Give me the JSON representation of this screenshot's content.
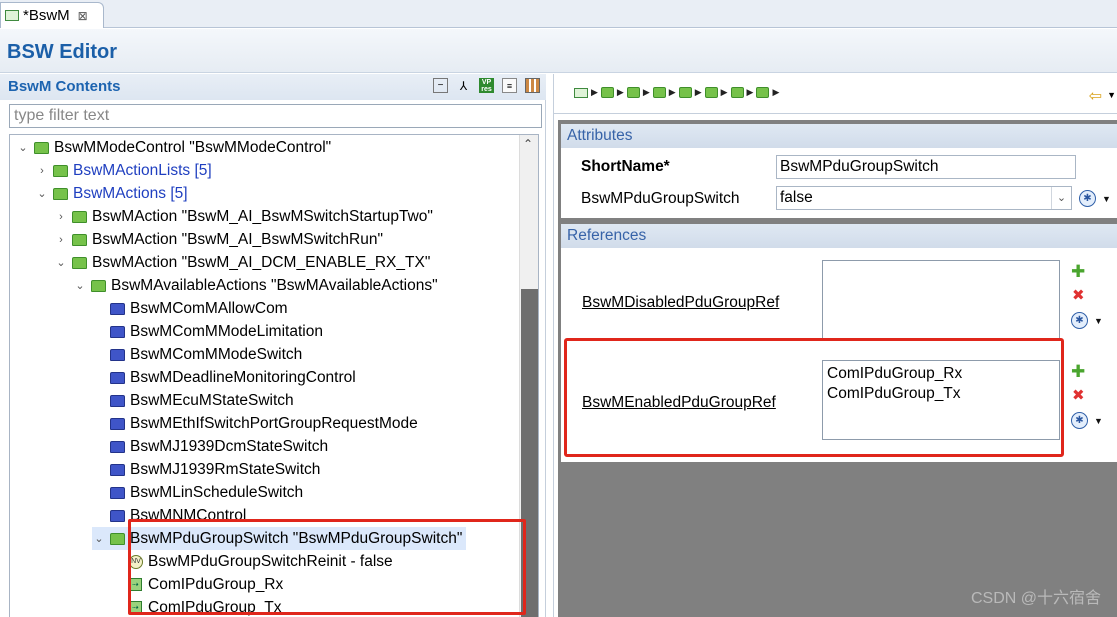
{
  "tab": {
    "title": "*BswM",
    "close_glyph": "⊠"
  },
  "editor": {
    "title": "BSW Editor"
  },
  "left_panel": {
    "title": "BswM Contents",
    "filter_placeholder": "type filter text",
    "tree": [
      {
        "label": "BswMModeControl \"BswMModeControl\"",
        "arrow": "⌄",
        "icon": "folder-green",
        "link": false
      },
      {
        "label": "BswMActionLists [5]",
        "arrow": "›",
        "icon": "folder-green",
        "link": true
      },
      {
        "label": "BswMActions [5]",
        "arrow": "⌄",
        "icon": "folder-green",
        "link": true
      },
      {
        "label": "BswMAction \"BswM_AI_BswMSwitchStartupTwo\"",
        "arrow": "›",
        "icon": "folder-green",
        "link": false
      },
      {
        "label": "BswMAction \"BswM_AI_BswMSwitchRun\"",
        "arrow": "›",
        "icon": "folder-green",
        "link": false
      },
      {
        "label": "BswMAction \"BswM_AI_DCM_ENABLE_RX_TX\"",
        "arrow": "⌄",
        "icon": "folder-green",
        "link": false
      },
      {
        "label": "BswMAvailableActions \"BswMAvailableActions\"",
        "arrow": "⌄",
        "icon": "folder-green",
        "link": false
      },
      {
        "label": "BswMComMAllowCom",
        "arrow": "",
        "icon": "folder-blue",
        "link": false
      },
      {
        "label": "BswMComMModeLimitation",
        "arrow": "",
        "icon": "folder-blue",
        "link": false
      },
      {
        "label": "BswMComMModeSwitch",
        "arrow": "",
        "icon": "folder-blue",
        "link": false
      },
      {
        "label": "BswMDeadlineMonitoringControl",
        "arrow": "",
        "icon": "folder-blue",
        "link": false
      },
      {
        "label": "BswMEcuMStateSwitch",
        "arrow": "",
        "icon": "folder-blue",
        "link": false
      },
      {
        "label": "BswMEthIfSwitchPortGroupRequestMode",
        "arrow": "",
        "icon": "folder-blue",
        "link": false
      },
      {
        "label": "BswMJ1939DcmStateSwitch",
        "arrow": "",
        "icon": "folder-blue",
        "link": false
      },
      {
        "label": "BswMJ1939RmStateSwitch",
        "arrow": "",
        "icon": "folder-blue",
        "link": false
      },
      {
        "label": "BswMLinScheduleSwitch",
        "arrow": "",
        "icon": "folder-blue",
        "link": false
      },
      {
        "label": "BswMNMControl",
        "arrow": "",
        "icon": "folder-blue",
        "link": false
      },
      {
        "label": "BswMPduGroupSwitch \"BswMPduGroupSwitch\"",
        "arrow": "⌄",
        "icon": "folder-green",
        "link": false,
        "selected": true
      },
      {
        "label": "BswMPduGroupSwitchReinit - false",
        "arrow": "",
        "icon": "nv",
        "link": false
      },
      {
        "label": "ComIPduGroup_Rx",
        "arrow": "",
        "icon": "ref",
        "link": false
      },
      {
        "label": "ComIPduGroup_Tx",
        "arrow": "",
        "icon": "ref",
        "link": false
      }
    ]
  },
  "right_panel": {
    "attributes": {
      "title": "Attributes",
      "short_name_label": "ShortName*",
      "short_name_value": "BswMPduGroupSwitch",
      "switch_label": "BswMPduGroupSwitch",
      "switch_value": "false"
    },
    "references": {
      "title": "References",
      "disabled_label": "BswMDisabledPduGroupRef",
      "disabled_values": [],
      "enabled_label": "BswMEnabledPduGroupRef",
      "enabled_values": [
        "ComIPduGroup_Rx",
        "ComIPduGroup_Tx"
      ]
    }
  },
  "watermark": "CSDN @十六宿舍",
  "colors": {
    "accent": "#1b5fa8",
    "highlight_box": "#e0261b"
  }
}
